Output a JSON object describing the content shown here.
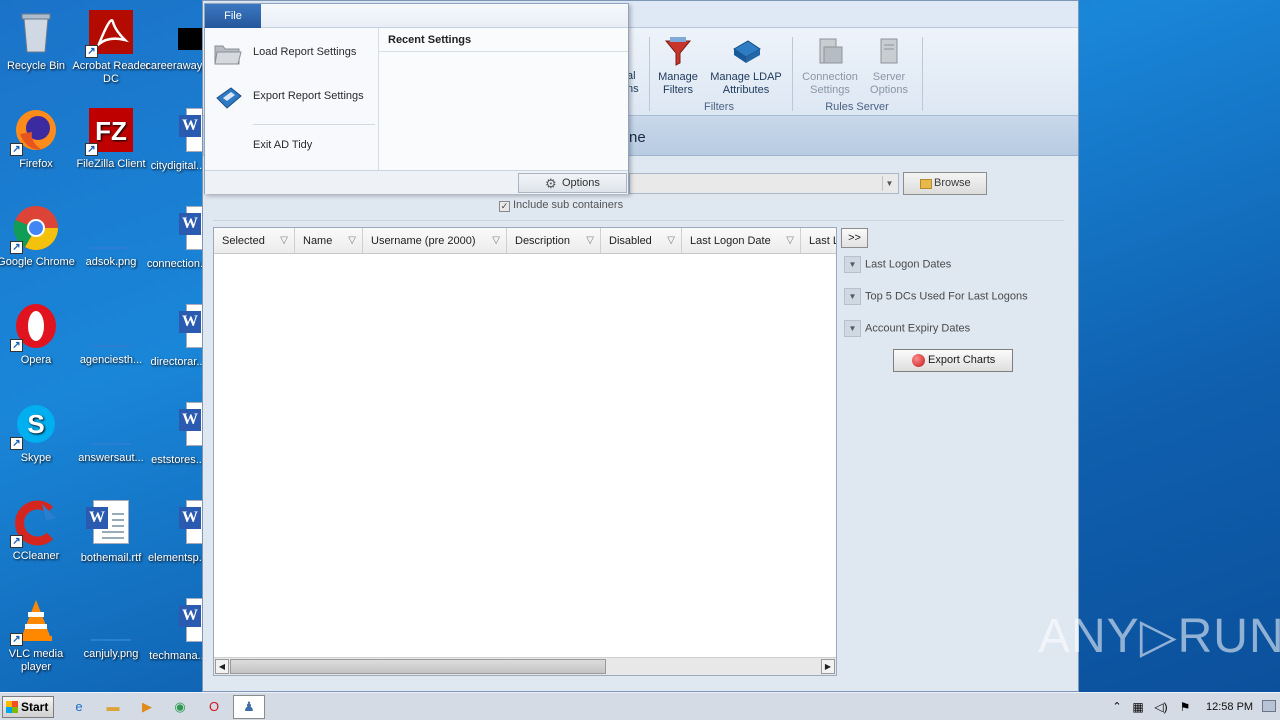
{
  "desktop": {
    "icons": [
      {
        "label": "Recycle Bin"
      },
      {
        "label": "Acrobat Reader DC"
      },
      {
        "label": "careeraway..."
      },
      {
        "label": "Firefox"
      },
      {
        "label": "FileZilla Client"
      },
      {
        "label": "citydigital..."
      },
      {
        "label": "Google Chrome"
      },
      {
        "label": "adsok.png"
      },
      {
        "label": "connection..."
      },
      {
        "label": "Opera"
      },
      {
        "label": "agenciesth..."
      },
      {
        "label": "directorar..."
      },
      {
        "label": "Skype"
      },
      {
        "label": "answersaut..."
      },
      {
        "label": "eststores..."
      },
      {
        "label": "CCleaner"
      },
      {
        "label": "bothemail.rtf"
      },
      {
        "label": "elementsp..."
      },
      {
        "label": "VLC media player"
      },
      {
        "label": "canjuly.png"
      },
      {
        "label": "techmana..."
      }
    ]
  },
  "file_menu": {
    "tab_label": "File",
    "items": [
      {
        "label": "Load Report Settings",
        "icon": "folder-open-icon"
      },
      {
        "label": "Export Report Settings",
        "icon": "save-disk-icon"
      },
      {
        "label": "Exit AD Tidy",
        "icon": "none"
      }
    ],
    "recent_header": "Recent Settings",
    "options_label": "Options"
  },
  "ribbon": {
    "partial_left": "al\nns",
    "buttons": [
      {
        "label_1": "Manage",
        "label_2": "Filters",
        "enabled": true
      },
      {
        "label_1": "Manage LDAP",
        "label_2": "Attributes",
        "enabled": true
      },
      {
        "label_1": "Connection",
        "label_2": "Settings",
        "enabled": false
      },
      {
        "label_1": "Server",
        "label_2": "Options",
        "enabled": false
      }
    ],
    "groups": {
      "filters": "Filters",
      "rules_server": "Rules Server"
    }
  },
  "page": {
    "title_partial": "ne",
    "browse_label": "Browse",
    "include_sub_containers": "Include sub containers",
    "grid_columns": [
      "Selected",
      "Name",
      "Username (pre 2000)",
      "Description",
      "Disabled",
      "Last Logon Date",
      "Last L"
    ],
    "toggle_label": ">>",
    "side_panels": [
      "Last Logon Dates",
      "Top 5 DCs Used For Last Logons",
      "Account Expiry Dates"
    ],
    "export_charts_label": "Export Charts"
  },
  "taskbar": {
    "start_label": "Start",
    "clock": "12:58 PM"
  },
  "watermark": "ANY▷RUN"
}
